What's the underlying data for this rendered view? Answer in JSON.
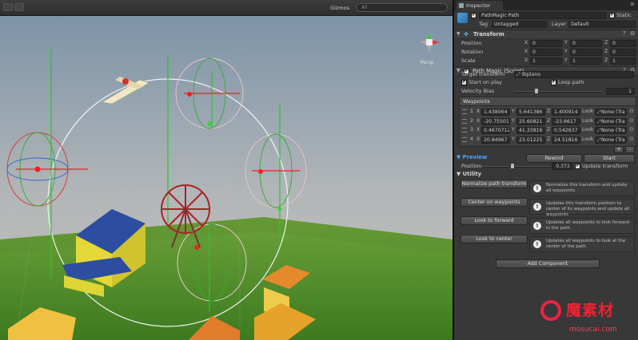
{
  "scene": {
    "gizmos_label": "Gizmos",
    "search_placeholder": "All",
    "persp_label": "Persp"
  },
  "inspector": {
    "tab_label": "Inspector",
    "object": {
      "name": "PathMagic Path",
      "static_label": "Static",
      "tag_label": "Tag",
      "tag_value": "Untagged",
      "layer_label": "Layer",
      "layer_value": "Default"
    },
    "transform": {
      "title": "Transform",
      "rows": [
        {
          "label": "Position",
          "x": "0",
          "y": "0",
          "z": "0"
        },
        {
          "label": "Rotation",
          "x": "0",
          "y": "0",
          "z": "0"
        },
        {
          "label": "Scale",
          "x": "1",
          "y": "1",
          "z": "1"
        }
      ]
    },
    "path_magic": {
      "title": "Path Magic (Script)",
      "target_label": "Target transform",
      "target_value": "Biplano",
      "start_on_play": "Start on play",
      "loop_path": "Loop path",
      "velocity_label": "Velocity Bias",
      "velocity_value": "1",
      "velocity_fraction": 0.25,
      "waypoints_label": "Waypoints",
      "look_label": "Look",
      "look_value": "None (Tra",
      "waypoints": [
        {
          "n": "1",
          "x": "1.438064",
          "y": "5.641386",
          "z": "1.400914"
        },
        {
          "n": "2",
          "x": "-20.75501",
          "y": "25.60821",
          "z": "-23.6617"
        },
        {
          "n": "3",
          "x": "0.4670712",
          "y": "41.33816",
          "z": "0.542637"
        },
        {
          "n": "4",
          "x": "20.84967",
          "y": "23.01225",
          "z": "24.51816"
        }
      ],
      "add_button": "+",
      "remove_button": "-"
    },
    "preview": {
      "title": "Preview",
      "rewind": "Rewind",
      "start": "Start",
      "position_label": "Position",
      "position_value": "0.372",
      "update_transform": "Update transform"
    },
    "utility": {
      "title": "Utility",
      "items": [
        {
          "button": "Normalize path transform",
          "info": "Normalize this transform and update all waypoints"
        },
        {
          "button": "Center on waypoints",
          "info": "Updates this transform position to center of its waypoints and update all waypoints"
        },
        {
          "button": "Look to forward",
          "info": "Updates all waypoints to look forward in the path"
        },
        {
          "button": "Look to center",
          "info": "Updates all waypoints to look at the center of the path"
        }
      ]
    },
    "add_component": "Add Component"
  },
  "watermark": {
    "brand": "魔素材",
    "url": "mosucai.com"
  }
}
